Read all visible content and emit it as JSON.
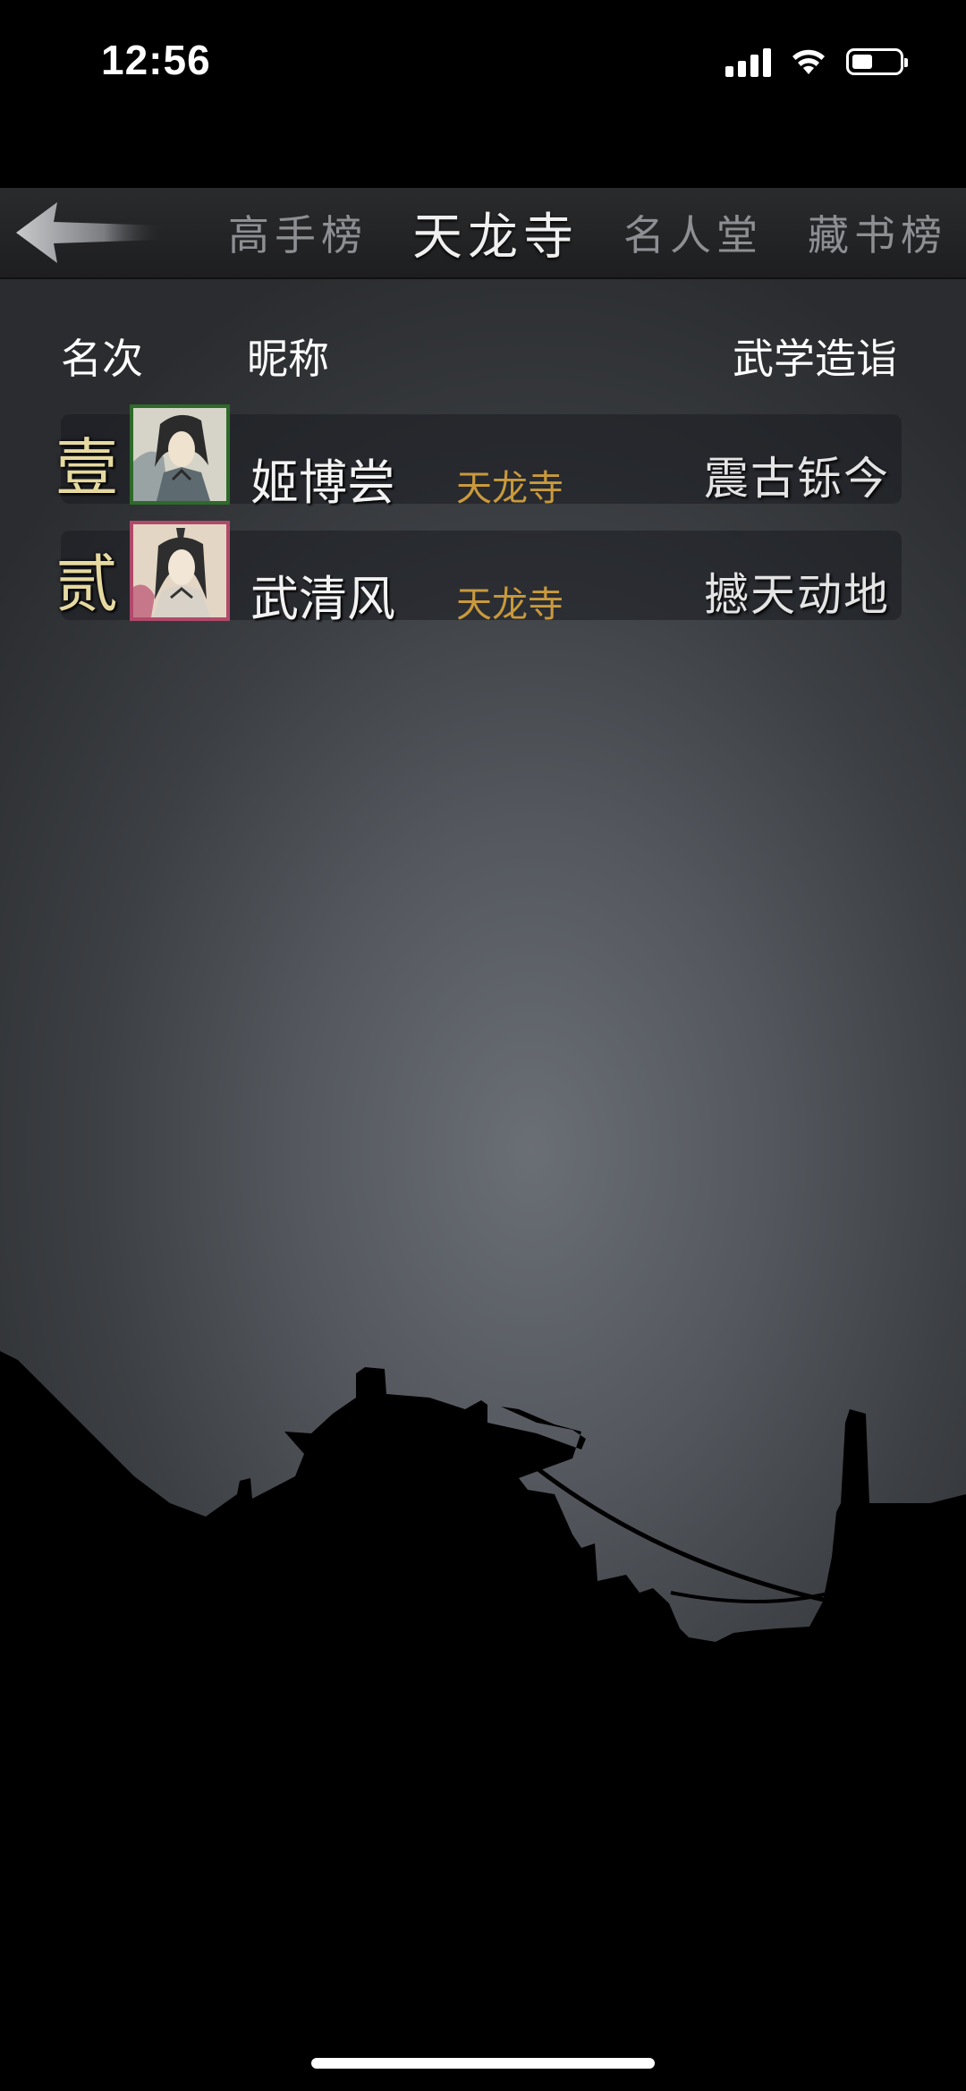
{
  "status_bar": {
    "time": "12:56"
  },
  "nav": {
    "tabs": [
      {
        "label": "高手榜",
        "active": false
      },
      {
        "label": "天龙寺",
        "active": true
      },
      {
        "label": "名人堂",
        "active": false
      },
      {
        "label": "藏书榜",
        "active": false
      }
    ]
  },
  "table": {
    "headers": {
      "rank": "名次",
      "nickname": "昵称",
      "skill": "武学造诣"
    },
    "rows": [
      {
        "rank": "壹",
        "name": "姬博尝",
        "sect": "天龙寺",
        "skill": "震古铄今",
        "avatar_icon": "character-portrait-icon"
      },
      {
        "rank": "贰",
        "name": "武清风",
        "sect": "天龙寺",
        "skill": "撼天动地",
        "avatar_icon": "character-portrait-icon"
      }
    ]
  },
  "colors": {
    "sect_text": "#c99a3d",
    "rank_text": "#e6d9a0"
  }
}
